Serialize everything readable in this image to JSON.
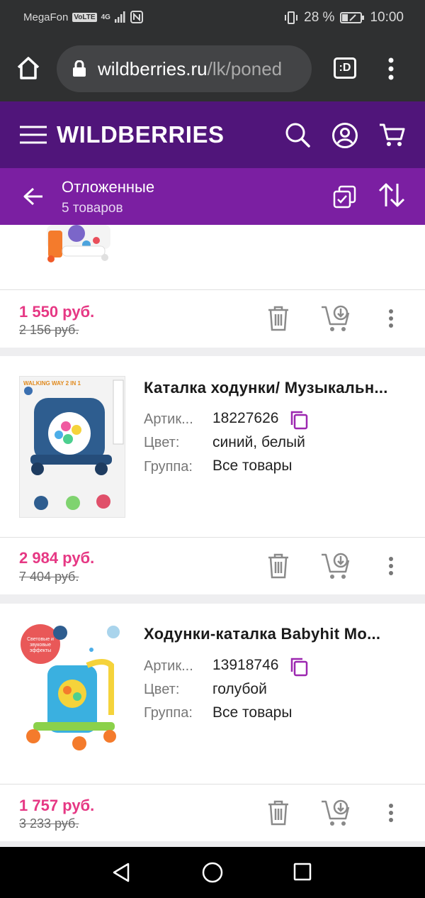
{
  "status_bar": {
    "carrier": "MegaFon",
    "volte": "VoLTE",
    "network": "4G",
    "battery": "28 %",
    "time": "10:00"
  },
  "browser": {
    "url_domain": "wildberries.ru",
    "url_path": "/lk/poned",
    "tab_label": ":D"
  },
  "header": {
    "logo": "WILDBERRIES"
  },
  "subheader": {
    "title": "Отложенные",
    "count": "5 товаров"
  },
  "products": [
    {
      "price_new": "1 550 руб.",
      "price_old": "2 156 руб."
    },
    {
      "name": "Каталка ходунки/ Музыкальн...",
      "label_article": "Артик...",
      "article": "18227626",
      "label_color": "Цвет:",
      "color": "синий, белый",
      "label_group": "Группа:",
      "group": "Все товары",
      "image_text": "WALKING WAY 2 IN 1",
      "price_new": "2 984 руб.",
      "price_old": "7 404 руб."
    },
    {
      "name": "Ходунки-каталка Babyhit Mo...",
      "label_article": "Артик...",
      "article": "13918746",
      "label_color": "Цвет:",
      "color": "голубой",
      "label_group": "Группа:",
      "group": "Все товары",
      "image_text": "Световые и звуковые эффекты",
      "price_new": "1 757 руб.",
      "price_old": "3 233 руб."
    }
  ],
  "colors": {
    "header": "#50157a",
    "subheader": "#7b1fa2",
    "price": "#e63884",
    "copy_icon": "#9c27b0"
  }
}
